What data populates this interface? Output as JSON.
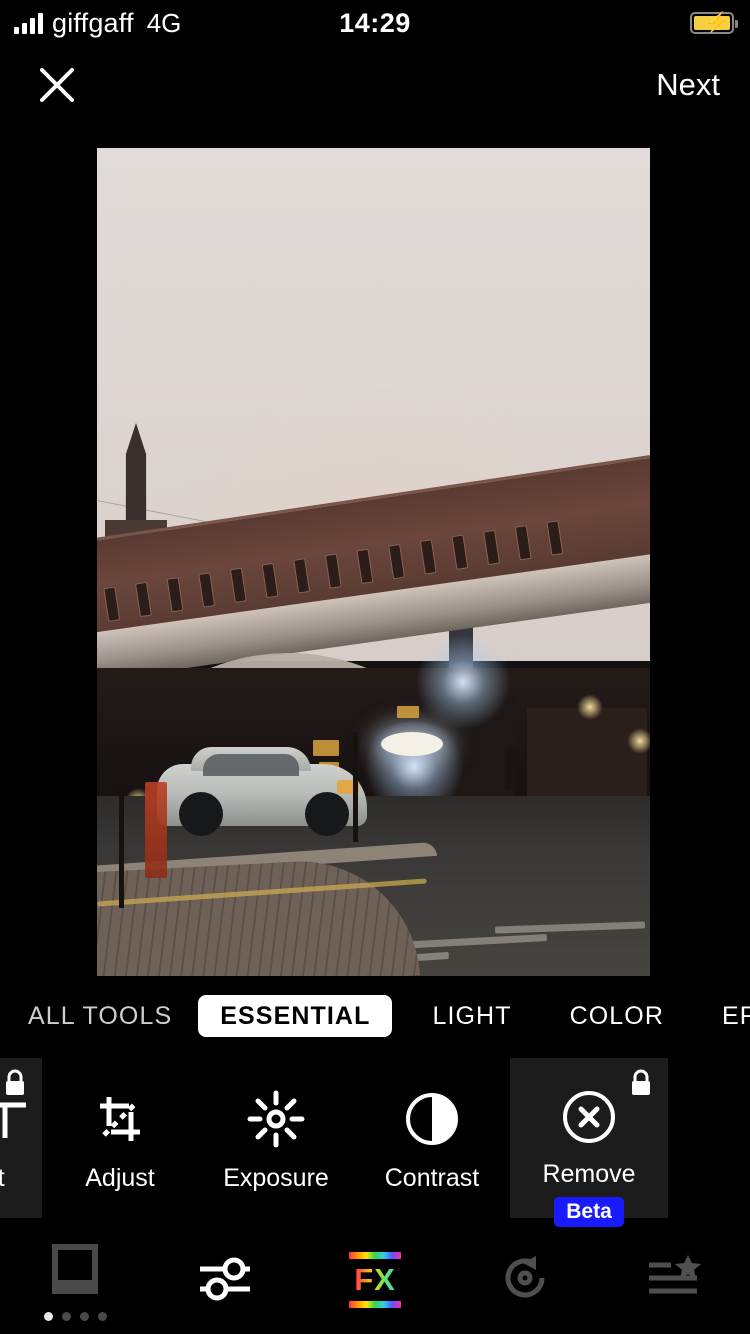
{
  "status_bar": {
    "carrier": "giffgaff",
    "network": "4G",
    "time": "14:29",
    "signal_icon": "signal-bars-icon",
    "battery_icon": "battery-charging-icon",
    "battery_charging": true,
    "battery_color": "#f7cf45"
  },
  "top_nav": {
    "close_icon": "close-icon",
    "next_label": "Next"
  },
  "canvas": {
    "image_alt": "city street at dusk with railway viaduct, church spire, parked silver car",
    "sky_color": "#ded6d3",
    "road_color": "#3a3836"
  },
  "categories": {
    "tabs": [
      {
        "label": "ALL TOOLS",
        "active": false,
        "clipped": true
      },
      {
        "label": "ESSENTIAL",
        "active": true,
        "clipped": false
      },
      {
        "label": "LIGHT",
        "active": false,
        "clipped": false
      },
      {
        "label": "COLOR",
        "active": false,
        "clipped": false
      },
      {
        "label": "EFFECTS",
        "active": false,
        "clipped": false
      }
    ]
  },
  "tools": [
    {
      "label": "ext",
      "icon": "text-tool-icon",
      "locked": true,
      "card": true,
      "badge": null
    },
    {
      "label": "Adjust",
      "icon": "crop-adjust-icon",
      "locked": false,
      "card": false,
      "badge": null
    },
    {
      "label": "Exposure",
      "icon": "sun-exposure-icon",
      "locked": false,
      "card": false,
      "badge": null
    },
    {
      "label": "Contrast",
      "icon": "contrast-half-circle-icon",
      "locked": false,
      "card": false,
      "badge": null
    },
    {
      "label": "Remove",
      "icon": "remove-circle-x-icon",
      "locked": true,
      "card": true,
      "badge": "Beta"
    }
  ],
  "bottom_bar": {
    "items": [
      {
        "icon": "filters-frame-icon",
        "active": true,
        "dots": 4,
        "active_dot": 1
      },
      {
        "icon": "adjust-sliders-icon",
        "active": true
      },
      {
        "icon": "fx-effects-icon",
        "label": "FX",
        "active": true
      },
      {
        "icon": "revert-history-icon",
        "active": false
      },
      {
        "icon": "presets-star-list-icon",
        "active": false
      }
    ]
  },
  "colors": {
    "background": "#000000",
    "card": "#1c1c1c",
    "accent_beta": "#1a1aff",
    "active_tab_bg": "#ffffff"
  }
}
